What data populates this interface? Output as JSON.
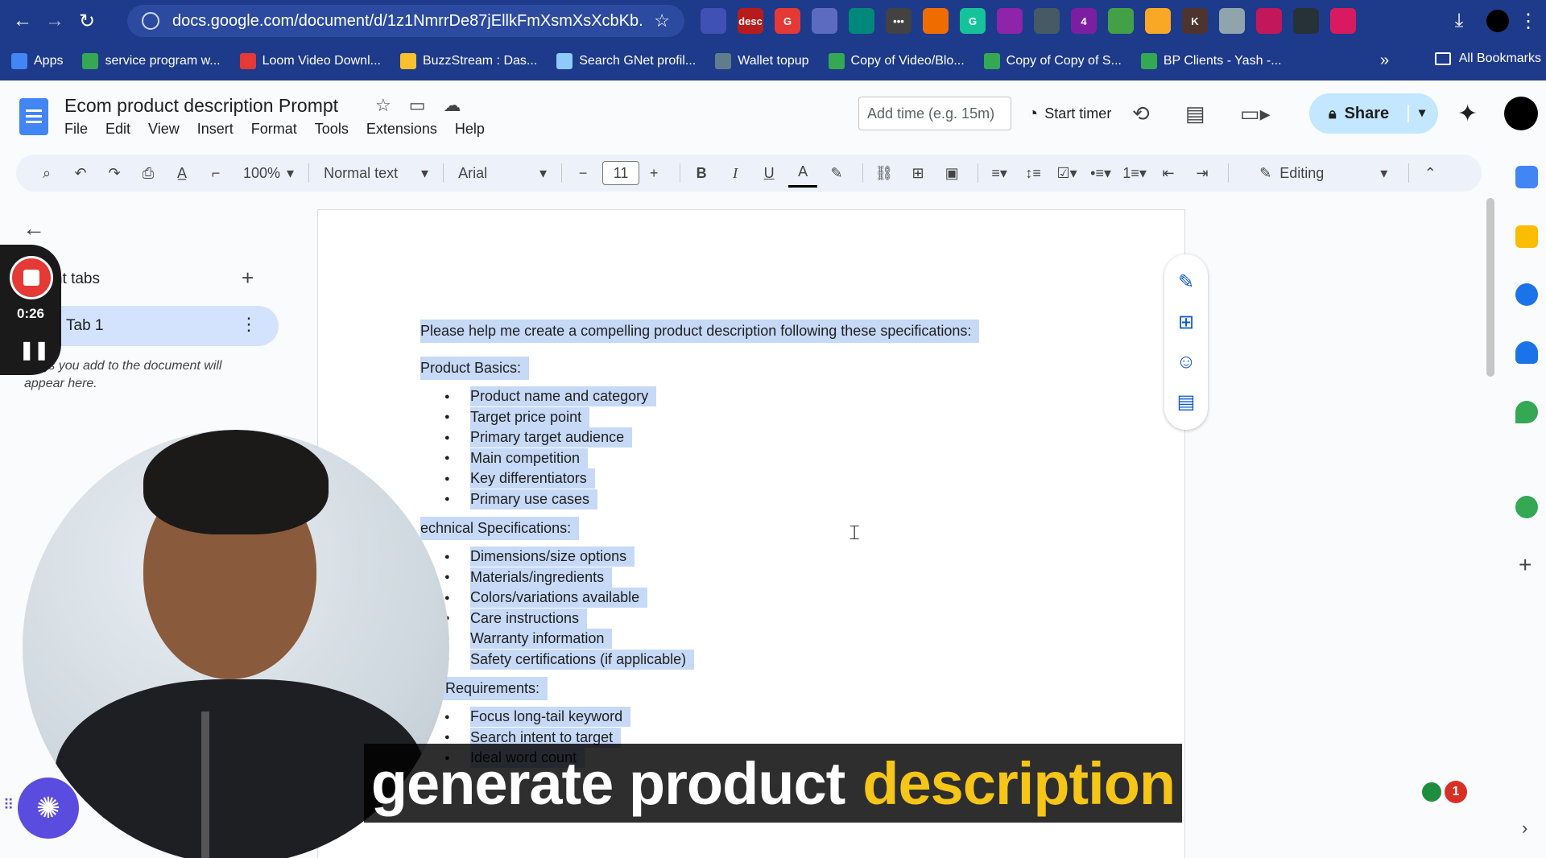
{
  "browser": {
    "url": "docs.google.com/document/d/1z1NmrrDe87jEllkFmXsmXsXcbKb...",
    "extensions": [
      {
        "name": "puzzle-ext",
        "label": "",
        "color": "#3f51b5"
      },
      {
        "name": "desc-ext",
        "label": "desc",
        "color": "#b71c1c"
      },
      {
        "name": "g-ext",
        "label": "G",
        "color": "#e53935"
      },
      {
        "name": "image-ext",
        "label": "",
        "color": "#5c6bc0"
      },
      {
        "name": "circle-ext",
        "label": "",
        "color": "#00897b"
      },
      {
        "name": "dots-ext",
        "label": "•••",
        "color": "#424242"
      },
      {
        "name": "orange-ext",
        "label": "",
        "color": "#ef6c00"
      },
      {
        "name": "grammarly-ext",
        "label": "G",
        "color": "#15c39a"
      },
      {
        "name": "ring-ext",
        "label": "",
        "color": "#8e24aa"
      },
      {
        "name": "video-ext",
        "label": "",
        "color": "#455a64"
      },
      {
        "name": "colorful-ext",
        "label": "4",
        "color": "#7b1fa2"
      },
      {
        "name": "leaf-ext",
        "label": "",
        "color": "#43a047"
      },
      {
        "name": "gold-ext",
        "label": "",
        "color": "#f9a825"
      },
      {
        "name": "k-ext",
        "label": "K",
        "color": "#4e342e"
      },
      {
        "name": "shield-ext",
        "label": "",
        "color": "#90a4ae"
      },
      {
        "name": "target-ext",
        "label": "",
        "color": "#c2185b"
      },
      {
        "name": "diamond-ext",
        "label": "",
        "color": "#263238"
      },
      {
        "name": "pink-ext",
        "label": "",
        "color": "#d81b60"
      }
    ],
    "bookmarks": [
      {
        "label": "Apps",
        "icon": "apps-grid-icon",
        "color": "#4285f4"
      },
      {
        "label": "service program w...",
        "icon": "sheets-icon",
        "color": "#34a853"
      },
      {
        "label": "Loom Video Downl...",
        "icon": "loom-icon",
        "color": "#e53935"
      },
      {
        "label": "BuzzStream : Das...",
        "icon": "buzzstream-icon",
        "color": "#fbc02d"
      },
      {
        "label": "Search GNet profil...",
        "icon": "gnet-icon",
        "color": "#90caf9"
      },
      {
        "label": "Wallet topup",
        "icon": "wallet-icon",
        "color": "#607d8b"
      },
      {
        "label": "Copy of Video/Blo...",
        "icon": "sheets-icon",
        "color": "#34a853"
      },
      {
        "label": "Copy of Copy of S...",
        "icon": "sheets-icon",
        "color": "#34a853"
      },
      {
        "label": "BP Clients - Yash -...",
        "icon": "sheets-icon",
        "color": "#34a853"
      }
    ],
    "bookmarks_more": "»",
    "all_bookmarks": "All Bookmarks"
  },
  "docs": {
    "title": "Ecom product description Prompt",
    "menu": [
      "File",
      "Edit",
      "View",
      "Insert",
      "Format",
      "Tools",
      "Extensions",
      "Help"
    ],
    "time_placeholder": "Add time (e.g. 15m)",
    "start_timer": "Start timer",
    "share": "Share",
    "toolbar": {
      "zoom": "100%",
      "style": "Normal text",
      "font": "Arial",
      "font_size": "11",
      "mode": "Editing"
    }
  },
  "sidebar": {
    "tabs_label": "ument tabs",
    "tab_name": "Tab 1",
    "hint": "dings you add to the document will appear here."
  },
  "recording": {
    "time": "0:26"
  },
  "document": {
    "intro": "Please help me create a compelling product description following these specifications:",
    "sections": [
      {
        "heading": "Product Basics:",
        "items": [
          "Product name and category",
          "Target price point",
          "Primary target audience",
          "Main competition",
          "Key differentiators",
          "Primary use cases"
        ]
      },
      {
        "heading": "echnical Specifications:",
        "items": [
          "Dimensions/size options",
          "Materials/ingredients",
          "Colors/variations available",
          "Care instructions",
          "Warranty information",
          "Safety certifications (if applicable)"
        ]
      },
      {
        "heading": "EO Requirements:",
        "items": [
          "Focus long-tail keyword",
          "Search intent to target",
          "Ideal word count"
        ]
      }
    ]
  },
  "caption": {
    "part1": "generate product",
    "part2": "description"
  },
  "notification": {
    "count": "1"
  },
  "colors": {
    "chrome": "#1e3a8a",
    "selection": "#c6d9f6",
    "share": "#c2e7ff",
    "caption_highlight": "#f5c518",
    "record": "#e53935"
  }
}
